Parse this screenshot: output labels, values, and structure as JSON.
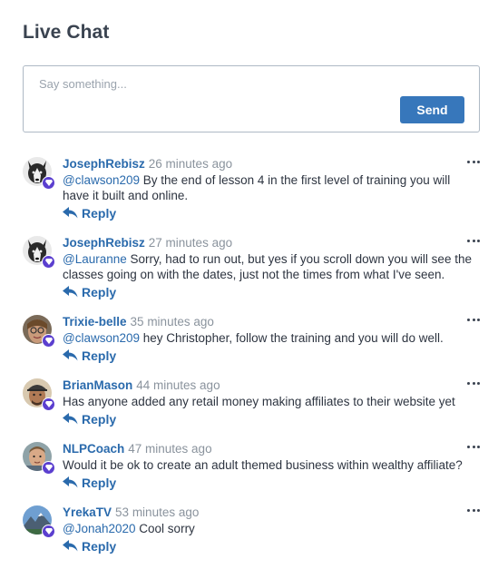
{
  "header": {
    "title": "Live Chat"
  },
  "compose": {
    "placeholder": "Say something...",
    "send_label": "Send"
  },
  "reply_label": "Reply",
  "colors": {
    "accent": "#3777bb",
    "link": "#2a6aac",
    "badge": "#5b3fcf"
  },
  "messages": [
    {
      "author": "JosephRebisz",
      "time": "26 minutes ago",
      "mention": "@clawson209",
      "text": "By the end of lesson 4 in the first level of training you will have it built and online.",
      "avatar": "husky-avatar"
    },
    {
      "author": "JosephRebisz",
      "time": "27 minutes ago",
      "mention": "@Lauranne",
      "text": "Sorry, had to run out, but yes if you scroll down you will see the classes going on with the dates, just not the times from what I've seen.",
      "avatar": "husky-avatar"
    },
    {
      "author": "Trixie-belle",
      "time": "35 minutes ago",
      "mention": "@clawson209",
      "text": "hey Christopher, follow the training and you will do well.",
      "avatar": "woman-glasses-avatar"
    },
    {
      "author": "BrianMason",
      "time": "44 minutes ago",
      "mention": "",
      "text": "Has anyone added any retail money making affiliates to their website yet",
      "avatar": "man-cap-avatar"
    },
    {
      "author": "NLPCoach",
      "time": "47 minutes ago",
      "mention": "",
      "text": "Would it be ok to create an adult themed business within wealthy affiliate?",
      "avatar": "man-portrait-avatar"
    },
    {
      "author": "YrekaTV",
      "time": "53 minutes ago",
      "mention": "@Jonah2020",
      "text": "Cool sorry",
      "avatar": "mountain-avatar"
    }
  ]
}
